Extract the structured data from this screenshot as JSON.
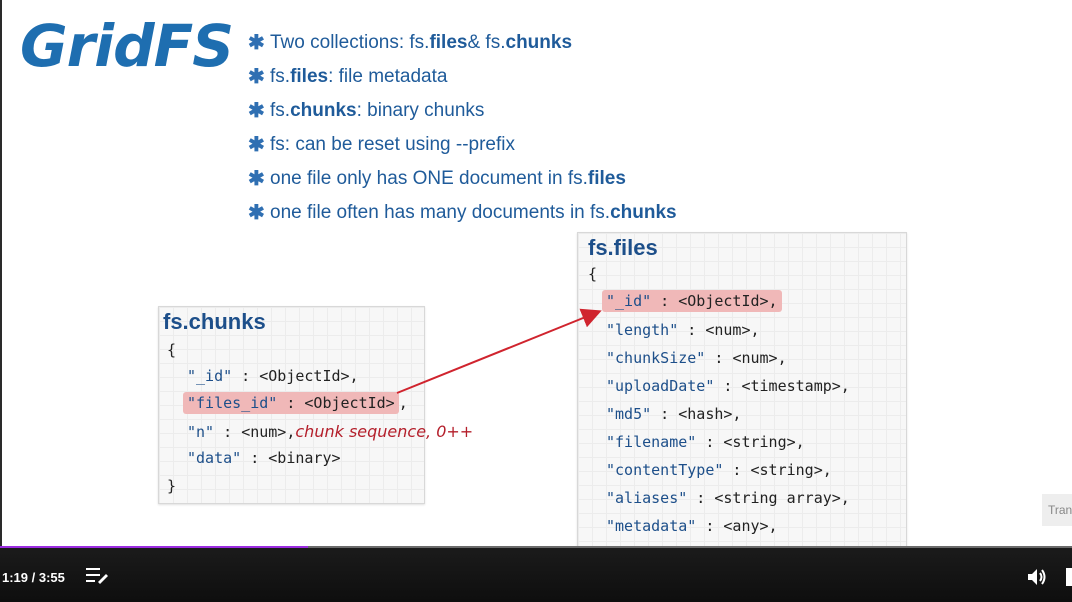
{
  "slide": {
    "title": "GridFS",
    "bullets": [
      {
        "pre": "Two collections: fs.",
        "b1": "files",
        "mid": " & fs.",
        "b2": "chunks",
        "post": ""
      },
      {
        "pre": "fs.",
        "b1": "files",
        "mid": ": file metadata",
        "b2": "",
        "post": ""
      },
      {
        "pre": "fs.",
        "b1": "chunks",
        "mid": ": binary chunks",
        "b2": "",
        "post": ""
      },
      {
        "pre": "fs: can be reset using --prefix",
        "b1": "",
        "mid": "",
        "b2": "",
        "post": ""
      },
      {
        "pre": "one file only has ONE document in fs.",
        "b1": "files",
        "mid": "",
        "b2": "",
        "post": ""
      },
      {
        "pre": "one file often has many documents in fs.",
        "b1": "chunks",
        "mid": "",
        "b2": "",
        "post": ""
      }
    ],
    "bullet_marker": "✱",
    "chunks_box": {
      "title": "fs.chunks",
      "open": "{",
      "close": "}",
      "lines": [
        {
          "key": "\"_id\"",
          "sep": " : ",
          "val": "<ObjectId>,"
        },
        {
          "key": "\"files_id\"",
          "sep": " : ",
          "val": "<ObjectId>",
          "tail": ","
        },
        {
          "key": "\"n\"",
          "sep": " : ",
          "val": "<num>,",
          "note": "chunk sequence, 0++"
        },
        {
          "key": "\"data\"",
          "sep": " : ",
          "val": "<binary>"
        }
      ]
    },
    "files_box": {
      "title": "fs.files",
      "open": "{",
      "close": "}",
      "lines": [
        {
          "key": "\"_id\"",
          "sep": " : ",
          "val": "<ObjectId>,"
        },
        {
          "key": "\"length\"",
          "sep": " : ",
          "val": "<num>,"
        },
        {
          "key": "\"chunkSize\"",
          "sep": " : ",
          "val": "<num>,"
        },
        {
          "key": "\"uploadDate\"",
          "sep": " : ",
          "val": "<timestamp>,"
        },
        {
          "key": "\"md5\"",
          "sep": " : ",
          "val": "<hash>,"
        },
        {
          "key": "\"filename\"",
          "sep": " : ",
          "val": "<string>,"
        },
        {
          "key": "\"contentType\"",
          "sep": " : ",
          "val": "<string>,"
        },
        {
          "key": "\"aliases\"",
          "sep": " : ",
          "val": "<string array>,"
        },
        {
          "key": "\"metadata\"",
          "sep": " : ",
          "val": "<any>,"
        }
      ]
    },
    "colors": {
      "title": "#1e6eb0",
      "bullet_text": "#1f5b9a",
      "highlight": "#f0b8b8",
      "arrow": "#d0242e",
      "note": "#b41e2a"
    }
  },
  "player": {
    "time": "1:19 / 3:55",
    "progress": 0.287,
    "transcript_label": "Tran",
    "icons": [
      "playlist-icon",
      "volume-icon"
    ],
    "accent": "#9b2ce0"
  }
}
